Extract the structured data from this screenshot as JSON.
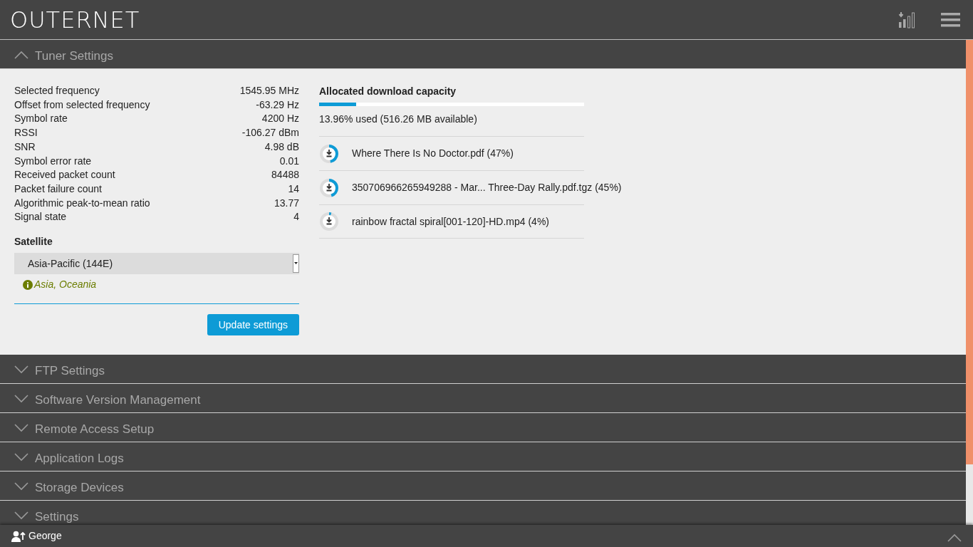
{
  "header": {
    "logo": "OUTERNET"
  },
  "sections": [
    {
      "title": "Tuner Settings",
      "expanded": true
    },
    {
      "title": "FTP Settings",
      "expanded": false
    },
    {
      "title": "Software Version Management",
      "expanded": false
    },
    {
      "title": "Remote Access Setup",
      "expanded": false
    },
    {
      "title": "Application Logs",
      "expanded": false
    },
    {
      "title": "Storage Devices",
      "expanded": false
    },
    {
      "title": "Settings",
      "expanded": false
    }
  ],
  "tuner": {
    "stats": [
      {
        "label": "Selected frequency",
        "value": "1545.95 MHz"
      },
      {
        "label": "Offset from selected frequency",
        "value": "-63.29 Hz"
      },
      {
        "label": "Symbol rate",
        "value": "4200 Hz"
      },
      {
        "label": "RSSI",
        "value": "-106.27 dBm"
      },
      {
        "label": "SNR",
        "value": "4.98 dB"
      },
      {
        "label": "Symbol error rate",
        "value": "0.01"
      },
      {
        "label": "Received packet count",
        "value": "84488"
      },
      {
        "label": "Packet failure count",
        "value": "14"
      },
      {
        "label": "Algorithmic peak-to-mean ratio",
        "value": "13.77"
      },
      {
        "label": "Signal state",
        "value": "4"
      }
    ],
    "satellite_label": "Satellite",
    "satellite_value": "Asia-Pacific (144E)",
    "coverage_note": "Asia, Oceania",
    "update_button": "Update settings"
  },
  "capacity": {
    "title": "Allocated download capacity",
    "level": 0.1396,
    "summary": "13.96% used (516.26 MB available)",
    "downloads": [
      {
        "name": "Where There Is No Doctor.pdf (47%)",
        "level": 0.47
      },
      {
        "name": "350706966265949288 - Mar... Three-Day Rally.pdf.tgz (45%)",
        "level": 0.45
      },
      {
        "name": "rainbow fractal spiral[001-120]-HD.mp4 (4%)",
        "level": 0.04
      }
    ]
  },
  "footer": {
    "user": "George"
  }
}
